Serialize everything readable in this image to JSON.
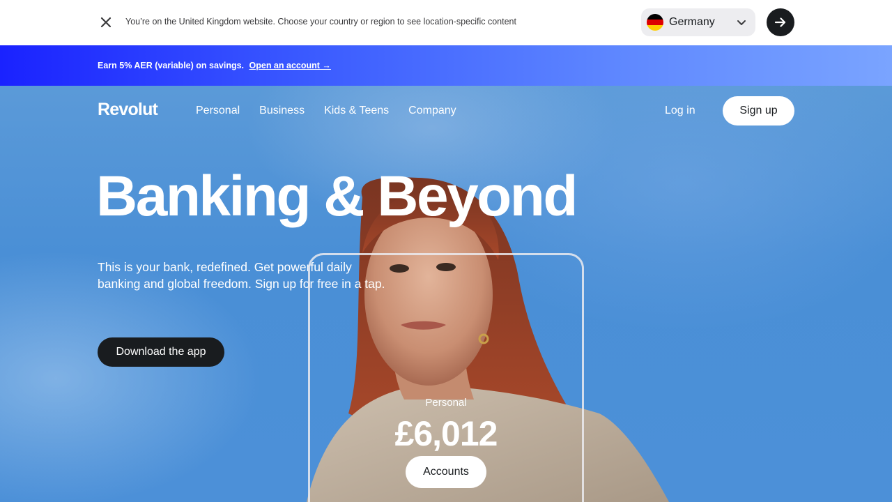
{
  "country_bar": {
    "message": "You’re on the United Kingdom website. Choose your country or region to see location-specific content",
    "selected_country": "Germany",
    "close_icon": "close-icon",
    "go_icon": "arrow-right-icon"
  },
  "promo": {
    "text": "Earn 5% AER (variable) on savings.",
    "link": "Open an account →"
  },
  "nav": {
    "logo": "Revolut",
    "items": [
      {
        "label": "Personal"
      },
      {
        "label": "Business"
      },
      {
        "label": "Kids & Teens"
      },
      {
        "label": "Company"
      }
    ],
    "login": "Log in",
    "signup": "Sign up"
  },
  "hero": {
    "headline": "Banking & Beyond",
    "subtext": "This is your bank, redefined. Get powerful daily banking and global freedom. Sign up for free in a tap.",
    "cta": "Download the app"
  },
  "phone_card": {
    "label": "Personal",
    "amount": "£6,012",
    "button": "Accounts"
  },
  "colors": {
    "accent_dark": "#191c1f",
    "promo_start": "#1a22ff",
    "promo_end": "#7aa4ff",
    "hero_sky": "#4a8fd6"
  }
}
